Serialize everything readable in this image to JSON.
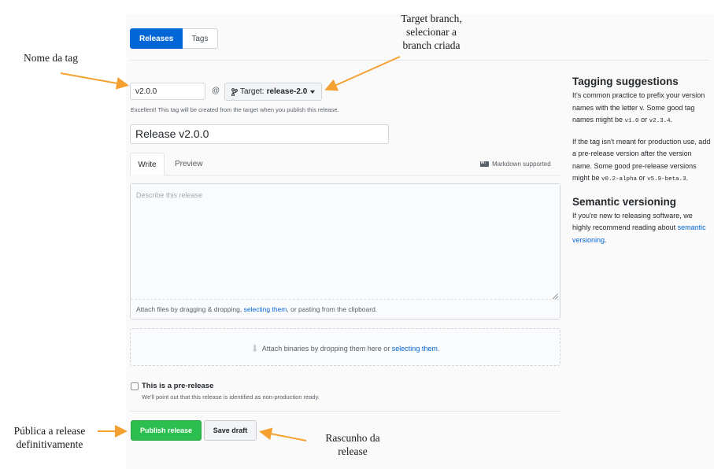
{
  "tabs": {
    "releases": "Releases",
    "tags": "Tags"
  },
  "form": {
    "tag_value": "v2.0.0",
    "at_symbol": "@",
    "target_prefix": "Target:",
    "target_branch": "release-2.0",
    "tag_hint": "Excellent! This tag will be created from the target when you publish this release.",
    "title_value": "Release v2.0.0",
    "write_tab": "Write",
    "preview_tab": "Preview",
    "markdown_label": "Markdown supported",
    "description_placeholder": "Describe this release",
    "attach_before": "Attach files by dragging & dropping, ",
    "attach_link": "selecting them",
    "attach_after": ", or pasting from the clipboard.",
    "binaries_before": "Attach binaries by dropping them here or ",
    "binaries_link": "selecting them",
    "binaries_after": ".",
    "prerelease_label": "This is a pre-release",
    "prerelease_note": "We'll point out that this release is identified as non-production ready.",
    "publish_button": "Publish release",
    "draft_button": "Save draft"
  },
  "sidebar": {
    "tagging_heading": "Tagging suggestions",
    "p1_a": "It's common practice to prefix your version names with the letter ",
    "p1_v": "v",
    "p1_b": ". Some good tag names might be ",
    "p1_ex1": "v1.0",
    "p1_or": " or ",
    "p1_ex2": "v2.3.4",
    "p1_end": ".",
    "p2_a": "If the tag isn't meant for production use, add a pre-release version after the version name. Some good pre-release versions might be ",
    "p2_ex1": "v0.2-alpha",
    "p2_or": " or ",
    "p2_ex2": "v5.9-beta.3",
    "p2_end": ".",
    "semver_heading": "Semantic versioning",
    "p3_a": "If you're new to releasing software, we highly recommend reading about ",
    "p3_link": "semantic versioning",
    "p3_end": "."
  },
  "annotations": {
    "tag_name": "Nome da tag",
    "target_1": "Target branch,",
    "target_2": "selecionar a",
    "target_3": "branch criada",
    "publish_1": "Pública a release",
    "publish_2": "definitivamente",
    "draft_1": "Rascunho da",
    "draft_2": "release"
  },
  "colors": {
    "accent": "#0366d6",
    "publish": "#2cbe4e",
    "arrow": "#f5a132"
  },
  "icons": {
    "branch": "git-branch-icon",
    "markdown": "markdown-icon",
    "upload": "upload-arrow-icon"
  }
}
